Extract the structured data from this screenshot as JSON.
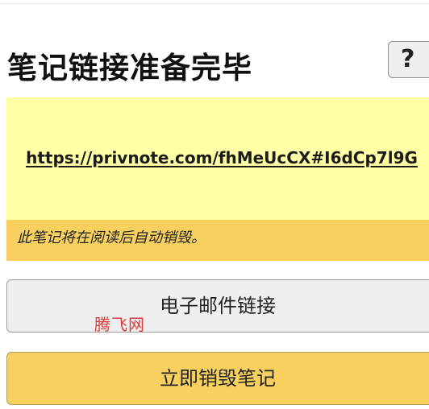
{
  "title": "笔记链接准备完毕",
  "help_button": {
    "label": "?"
  },
  "note_link": "https://privnote.com/fhMeUcCX#I6dCp7l9G",
  "notice": "此笔记将在阅读后自动销毁。",
  "buttons": {
    "email_link": "电子邮件链接",
    "destroy_now": "立即销毁笔记"
  },
  "watermark": "腾飞网",
  "colors": {
    "link_box_bg": "#ffffa5",
    "notice_bg": "#f7d060",
    "email_button_bg": "#efefef",
    "destroy_button_bg": "#f7d060",
    "watermark": "#d83a3a"
  }
}
